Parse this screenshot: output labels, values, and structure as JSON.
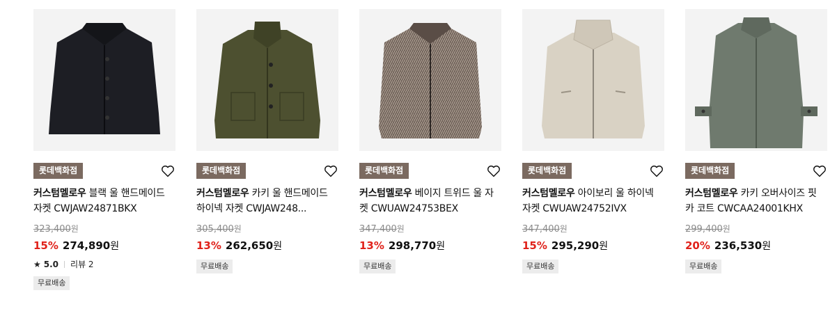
{
  "products": [
    {
      "store": "롯데백화점",
      "brand": "커스텀멜로우",
      "name": "블랙 울 핸드메이드 자켓 CWJAW24871BKX",
      "original_price": "323,400",
      "original_unit": "원",
      "discount": "15%",
      "price": "274,890",
      "price_unit": "원",
      "rating": "5.0",
      "review_label": "리뷰 2",
      "tag": "무료배송",
      "color": "#1d1e24"
    },
    {
      "store": "롯데백화점",
      "brand": "커스텀멜로우",
      "name": "카키 울 핸드메이드 하이넥 자켓 CWJAW248...",
      "original_price": "305,400",
      "original_unit": "원",
      "discount": "13%",
      "price": "262,650",
      "price_unit": "원",
      "tag": "무료배송",
      "color": "#4d5030"
    },
    {
      "store": "롯데백화점",
      "brand": "커스텀멜로우",
      "name": "베이지 트위드 울 자켓 CWUAW24753BEX",
      "original_price": "347,400",
      "original_unit": "원",
      "discount": "13%",
      "price": "298,770",
      "price_unit": "원",
      "tag": "무료배송",
      "color": "#6e6058"
    },
    {
      "store": "롯데백화점",
      "brand": "커스텀멜로우",
      "name": "아이보리 울 하이넥 자켓 CWUAW24752IVX",
      "original_price": "347,400",
      "original_unit": "원",
      "discount": "15%",
      "price": "295,290",
      "price_unit": "원",
      "tag": "무료배송",
      "color": "#d9d2c4"
    },
    {
      "store": "롯데백화점",
      "brand": "커스텀멜로우",
      "name": "카키 오버사이즈 핏 카 코트 CWCAA24001KHX",
      "original_price": "299,400",
      "original_unit": "원",
      "discount": "20%",
      "price": "236,530",
      "price_unit": "원",
      "tag": "무료배송",
      "color": "#6f7a6e"
    }
  ],
  "colors": {
    "badge": "#7b6a60",
    "discount": "#e0221b",
    "thumb_bg": "#f3f3f3"
  }
}
